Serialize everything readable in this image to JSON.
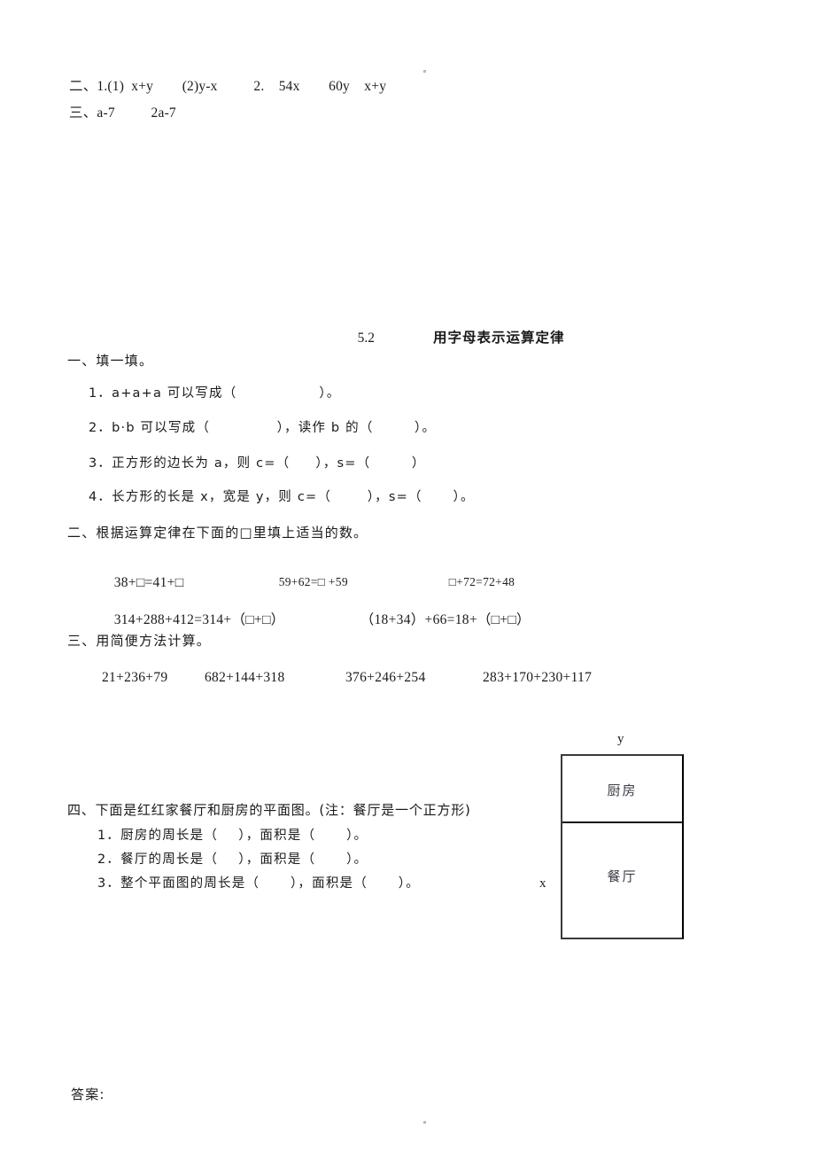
{
  "document": {
    "title_number": "5.2",
    "title_text": "用字母表示运算定律",
    "answers_label": "答案:"
  },
  "previous_answers": {
    "line1": "二、1.(1)  x+y        (2)y-x          2.    54x        60y    x+y",
    "line2": "三、a-7          2a-7"
  },
  "section_one": {
    "heading": "一、填一填。",
    "items": [
      "1．a+a+a 可以写成（                ）。",
      "2．b·b 可以写成（             ），读作 b 的（        ）。",
      "3．正方形的边长为 a，则 c=（     ），s=（        ）",
      "4．长方形的长是 x，宽是 y，则 c=（       ），s=（      ）。"
    ]
  },
  "section_two": {
    "heading": "二、根据运算定律在下面的□里填上适当的数。",
    "row1": [
      {
        "prefix": "38+",
        "mid": "=41+",
        "suffix": ""
      },
      {
        "prefix": "59+62=",
        "mid": " +59",
        "suffix": ""
      },
      {
        "prefix": "",
        "mid": "+72=72+48",
        "suffix": ""
      }
    ],
    "row2": [
      {
        "text_before": "314+288+412=314+（",
        "text_between": "+",
        "text_after": "）"
      },
      {
        "text_before": "（18+34）+66=18+（",
        "text_between": "+",
        "text_after": "）"
      }
    ],
    "row1_plain": [
      "38+□=41+□",
      "59+62=□ +59",
      "□+72=72+48"
    ],
    "row2_plain": [
      "314+288+412=314+（□+□）",
      "（18+34）+66=18+（□+□）"
    ]
  },
  "section_three": {
    "heading": "三、用简便方法计算。",
    "expressions": [
      "21+236+79",
      "682+144+318",
      "376+246+254",
      "283+170+230+117"
    ]
  },
  "section_four": {
    "heading": "四、下面是红红家餐厅和厨房的平面图。(注：餐厅是一个正方形)",
    "items": [
      "1．厨房的周长是（    ），面积是（      ）。",
      "2．餐厅的周长是（    ），面积是（      ）。",
      "3．整个平面图的周长是（      ），面积是（      ）。"
    ],
    "diagram": {
      "top_room_label": "厨房",
      "bottom_room_label": "餐厅",
      "width_label": "y",
      "height_label": "x"
    }
  }
}
